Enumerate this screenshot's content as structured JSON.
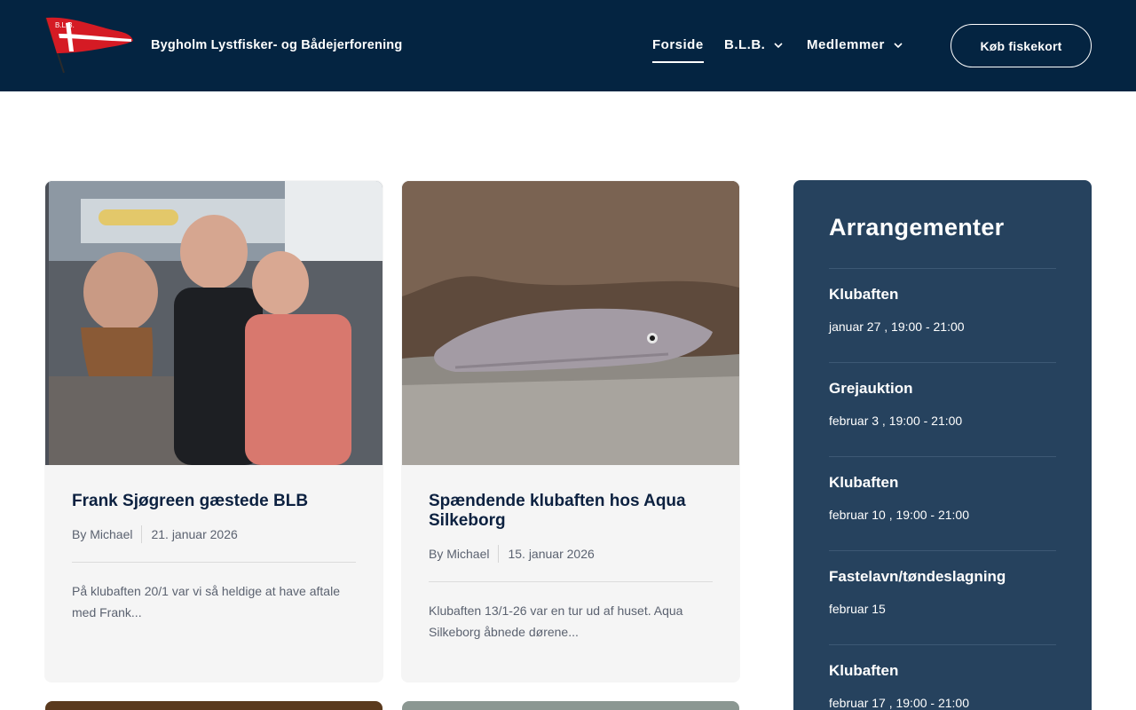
{
  "header": {
    "site_name": "Bygholm Lystfisker- og Bådejerforening",
    "logo_text": "B.L.B.",
    "nav": [
      {
        "label": "Forside",
        "active": true
      },
      {
        "label": "B.L.B.",
        "dropdown": true
      },
      {
        "label": "Medlemmer",
        "dropdown": true
      }
    ],
    "cta_label": "Køb fiskekort"
  },
  "posts": [
    {
      "title": "Frank Sjøgreen gæstede BLB",
      "author": "By Michael",
      "date": "21. januar 2026",
      "excerpt": "På klubaften 20/1 var vi så heldige at have aftale med Frank..."
    },
    {
      "title": "Spændende klubaften hos Aqua Silkeborg",
      "author": "By Michael",
      "date": "15. januar 2026",
      "excerpt": "Klubaften 13/1-26 var en tur ud af huset. Aqua Silkeborg åbnede dørene..."
    }
  ],
  "sidebar": {
    "title": "Arrangementer",
    "events": [
      {
        "title": "Klubaften",
        "date": "januar 27 , 19:00 - 21:00"
      },
      {
        "title": "Grejauktion",
        "date": "februar 3 , 19:00 - 21:00"
      },
      {
        "title": "Klubaften",
        "date": "februar 10 , 19:00 - 21:00"
      },
      {
        "title": "Fastelavn/tøndeslagning",
        "date": "februar 15"
      },
      {
        "title": "Klubaften",
        "date": "februar 17 , 19:00 - 21:00"
      }
    ]
  },
  "colors": {
    "header_bg": "#042441",
    "sidebar_bg": "#26425e",
    "card_bg": "#f5f5f5",
    "heading": "#0c2140"
  },
  "icons": {
    "logo": "danish-pennant-flag-icon",
    "dropdown": "chevron-down-icon"
  }
}
